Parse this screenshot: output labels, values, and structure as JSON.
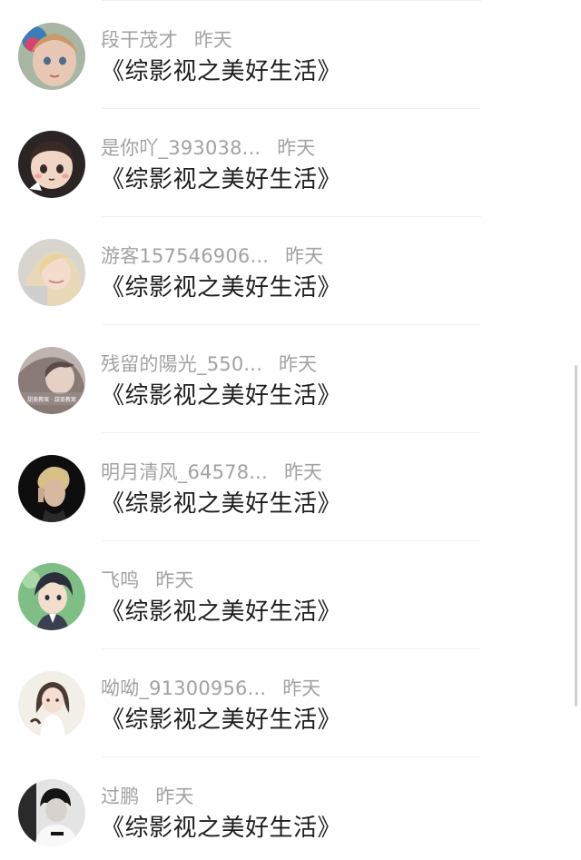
{
  "comments": [
    {
      "username": "段干茂才",
      "time": "昨天",
      "content": "《综影视之美好生活》",
      "avatar": "avatar-girl-doll"
    },
    {
      "username": "是你吖_393038...",
      "time": "昨天",
      "content": "《综影视之美好生活》",
      "avatar": "avatar-cartoon-girl"
    },
    {
      "username": "游客157546906...",
      "time": "昨天",
      "content": "《综影视之美好生活》",
      "avatar": "avatar-blonde-girl"
    },
    {
      "username": "残留的陽光_550...",
      "time": "昨天",
      "content": "《综影视之美好生活》",
      "avatar": "avatar-selfie-girl",
      "avatar_caption": "甜美教案 · 甜美教案"
    },
    {
      "username": "明月清风_64578...",
      "time": "昨天",
      "content": "《综影视之美好生活》",
      "avatar": "avatar-dark-blonde"
    },
    {
      "username": "飞鸣",
      "time": "昨天",
      "content": "《综影视之美好生活》",
      "avatar": "avatar-anime-boy"
    },
    {
      "username": "呦呦_91300956...",
      "time": "昨天",
      "content": "《综影视之美好生活》",
      "avatar": "avatar-illustrated-girl"
    },
    {
      "username": "过鹏",
      "time": "昨天",
      "content": "《综影视之美好生活》",
      "avatar": "avatar-black-white-boy"
    }
  ],
  "colors": {
    "username": "#a2a2a2",
    "time": "#a2a2a2",
    "content": "#1e1e1e",
    "divider": "#f0f0f0",
    "background": "#ffffff"
  }
}
